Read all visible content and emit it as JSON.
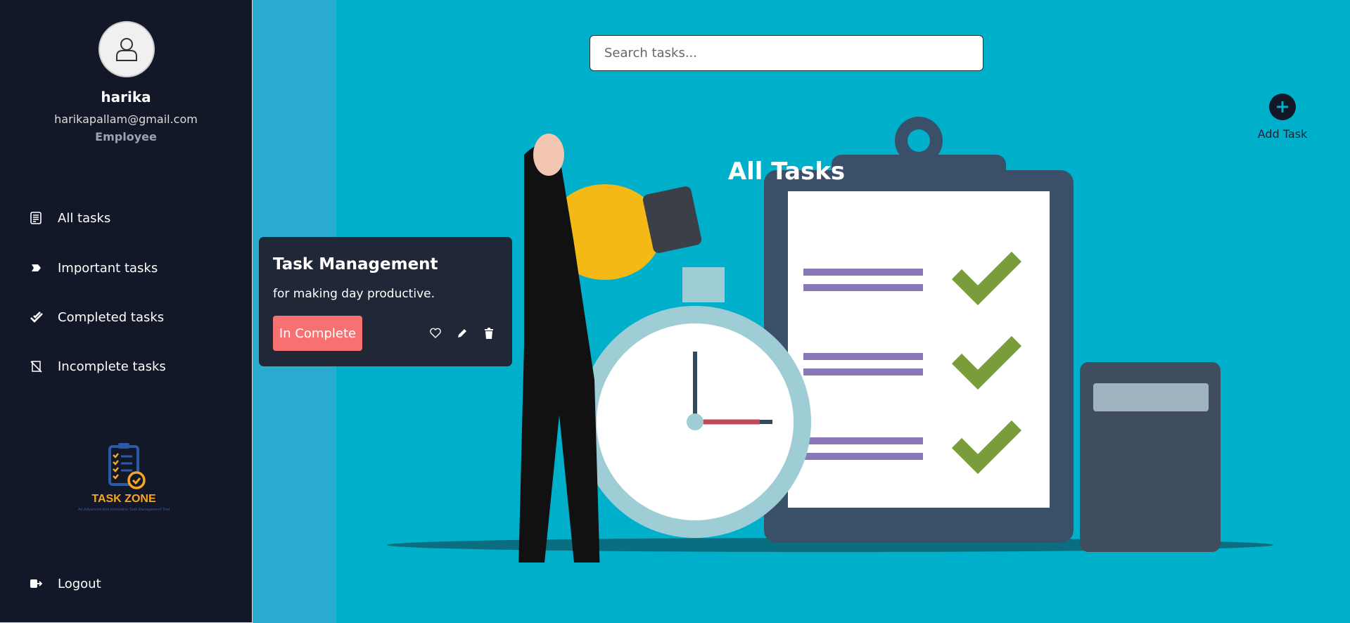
{
  "user": {
    "name": "harika",
    "email": "harikapallam@gmail.com",
    "role": "Employee"
  },
  "nav": [
    {
      "label": "All tasks",
      "icon": "list-icon"
    },
    {
      "label": "Important tasks",
      "icon": "tag-icon"
    },
    {
      "label": "Completed tasks",
      "icon": "double-check-icon"
    },
    {
      "label": "Incomplete tasks",
      "icon": "no-note-icon"
    }
  ],
  "logout": "Logout",
  "logo": {
    "name": "TASK ZONE",
    "tagline": "An Advanced And Innovative Task Management Tool"
  },
  "search": {
    "placeholder": "Search tasks...",
    "value": ""
  },
  "page_title": "All Tasks",
  "add_task": "Add Task",
  "tasks": [
    {
      "title": "Task Management",
      "description": "for making day productive.",
      "status": "In Complete",
      "status_color": "#f87171"
    }
  ],
  "colors": {
    "sidebar": "#121828",
    "main": "#00afca",
    "card": "#202838"
  }
}
